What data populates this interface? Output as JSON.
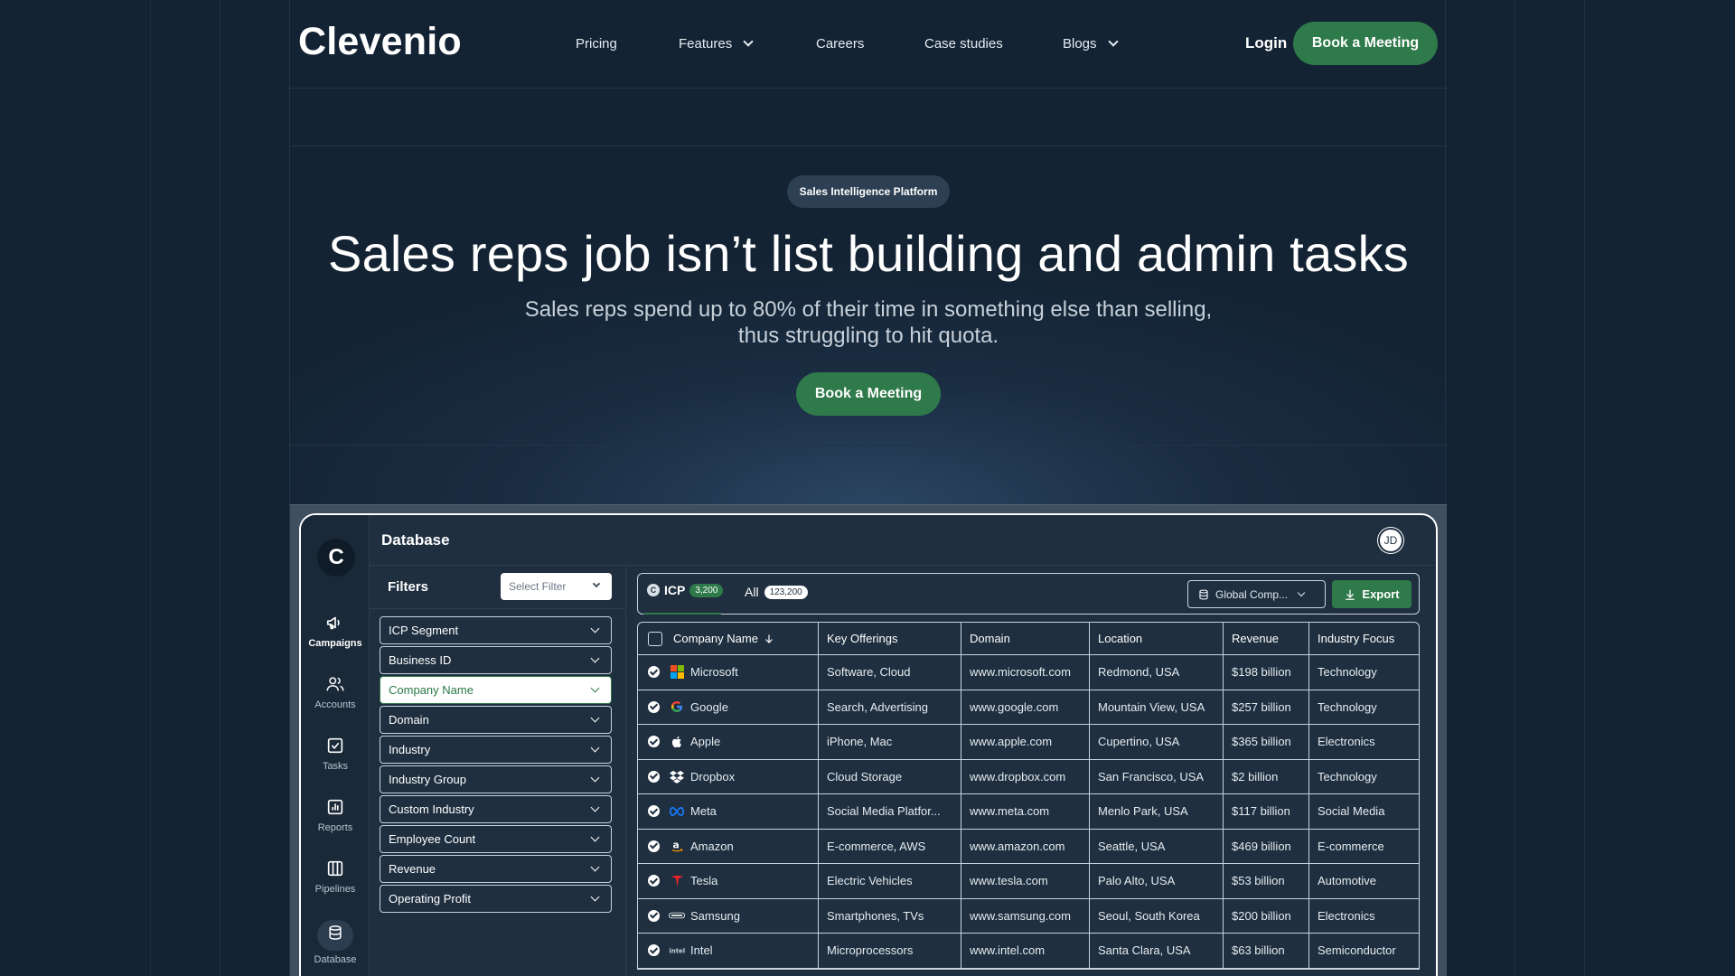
{
  "nav": {
    "logo": "Clevenio",
    "items": [
      {
        "label": "Pricing",
        "dropdown": false
      },
      {
        "label": "Features",
        "dropdown": true
      },
      {
        "label": "Careers",
        "dropdown": false
      },
      {
        "label": "Case studies",
        "dropdown": false
      },
      {
        "label": "Blogs",
        "dropdown": true
      }
    ],
    "login": "Login",
    "cta": "Book a Meeting"
  },
  "hero": {
    "pill": "Sales Intelligence Platform",
    "headline": "Sales reps job isn’t list building and admin tasks",
    "subline": "Sales reps spend up to 80% of their time in something else than selling, thus struggling to hit quota.",
    "cta": "Book a Meeting"
  },
  "app": {
    "rail_logo": "C",
    "title": "Database",
    "avatar": "JD",
    "rail": [
      {
        "label": "Campaigns",
        "icon": "megaphone-icon",
        "active": true
      },
      {
        "label": "Accounts",
        "icon": "users-icon",
        "active": false
      },
      {
        "label": "Tasks",
        "icon": "checkbox-icon",
        "active": false
      },
      {
        "label": "Reports",
        "icon": "chart-icon",
        "active": false
      },
      {
        "label": "Pipelines",
        "icon": "columns-icon",
        "active": false
      },
      {
        "label": "Database",
        "icon": "database-icon",
        "active": false
      }
    ],
    "filters": {
      "title": "Filters",
      "select_placeholder": "Select Filter",
      "items": [
        "ICP Segment",
        "Business ID",
        "Company Name",
        "Domain",
        "Industry",
        "Industry Group",
        "Custom Industry",
        "Employee Count",
        "Revenue",
        "Operating Profit"
      ],
      "active": "Company Name"
    },
    "toolbar": {
      "icp_badge": "C",
      "icp_label": "ICP",
      "icp_count": "3,200",
      "all_label": "All",
      "all_count": "123,200",
      "global": "Global Comp...",
      "export": "Export"
    },
    "table": {
      "columns": [
        "Company Name",
        "Key Offerings",
        "Domain",
        "Location",
        "Revenue",
        "Industry Focus"
      ],
      "rows": [
        {
          "name": "Microsoft",
          "logo": "microsoft-logo",
          "offerings": "Software, Cloud",
          "domain": "www.microsoft.com",
          "location": "Redmond, USA",
          "revenue": "$198 billion",
          "industry": "Technology"
        },
        {
          "name": "Google",
          "logo": "google-logo",
          "offerings": "Search, Advertising",
          "domain": "www.google.com",
          "location": "Mountain View, USA",
          "revenue": "$257 billion",
          "industry": "Technology"
        },
        {
          "name": "Apple",
          "logo": "apple-logo",
          "offerings": "iPhone, Mac",
          "domain": "www.apple.com",
          "location": "Cupertino, USA",
          "revenue": "$365 billion",
          "industry": "Electronics"
        },
        {
          "name": "Dropbox",
          "logo": "dropbox-logo",
          "offerings": "Cloud Storage",
          "domain": "www.dropbox.com",
          "location": "San Francisco, USA",
          "revenue": "$2 billion",
          "industry": "Technology"
        },
        {
          "name": "Meta",
          "logo": "meta-logo",
          "offerings": "Social Media Platfor...",
          "domain": "www.meta.com",
          "location": "Menlo Park, USA",
          "revenue": "$117 billion",
          "industry": "Social Media"
        },
        {
          "name": "Amazon",
          "logo": "amazon-logo",
          "offerings": "E-commerce, AWS",
          "domain": "www.amazon.com",
          "location": "Seattle, USA",
          "revenue": "$469 billion",
          "industry": "E-commerce"
        },
        {
          "name": "Tesla",
          "logo": "tesla-logo",
          "offerings": "Electric Vehicles",
          "domain": "www.tesla.com",
          "location": "Palo Alto, USA",
          "revenue": "$53 billion",
          "industry": "Automotive"
        },
        {
          "name": "Samsung",
          "logo": "samsung-logo",
          "offerings": "Smartphones, TVs",
          "domain": "www.samsung.com",
          "location": "Seoul, South Korea",
          "revenue": "$200 billion",
          "industry": "Electronics"
        },
        {
          "name": "Intel",
          "logo": "intel-logo",
          "offerings": "Microprocessors",
          "domain": "www.intel.com",
          "location": "Santa Clara, USA",
          "revenue": "$63 billion",
          "industry": "Semiconductor"
        }
      ]
    }
  },
  "colors": {
    "background": "#132333",
    "accent": "#2f7a4a",
    "panel": "#1f2f40"
  }
}
